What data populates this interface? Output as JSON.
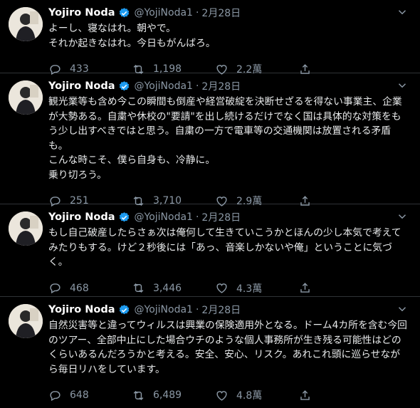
{
  "tweets": [
    {
      "name": "Yojiro Noda",
      "handle": "@YojiNoda1",
      "separator": "·",
      "date": "2月28日",
      "text": "よーし、寝なはれ。朝やで。\nそれか起きなはれ。今日もがんばろ。",
      "replies": "433",
      "retweets": "1,198",
      "likes": "2.2萬"
    },
    {
      "name": "Yojiro Noda",
      "handle": "@YojiNoda1",
      "separator": "·",
      "date": "2月28日",
      "text": "観光業等も含め今この瞬間も倒産や経営破綻を決断せざるを得ない事業主、企業が大勢ある。自粛や休校の\"要請\"を出し続けるだけでなく国は具体的な対策をもう少し出すべきではと思う。自粛の一方で電車等の交通機関は放置される矛盾も。\nこんな時こそ、僕ら自身も、冷静に。\n乗り切ろう。",
      "replies": "251",
      "retweets": "3,710",
      "likes": "2.9萬"
    },
    {
      "name": "Yojiro Noda",
      "handle": "@YojiNoda1",
      "separator": "·",
      "date": "2月28日",
      "text": "もし自己破産したらさぁ次は俺何して生きていこうかとほんの少し本気で考えてみたりもする。けど２秒後には「あっ、音楽しかないや俺」ということに気づく。",
      "replies": "468",
      "retweets": "3,446",
      "likes": "4.3萬"
    },
    {
      "name": "Yojiro Noda",
      "handle": "@YojiNoda1",
      "separator": "·",
      "date": "2月28日",
      "text": "自然災害等と違ってウィルスは興業の保険適用外となる。ドーム4カ所を含む今回のツアー、全部中止にした場合ウチのような個人事務所が生き残る可能性はどのくらいあるんだろうかと考える。安全、安心、リスク。あれこれ頭に巡らせながら毎日リハをしています。",
      "replies": "648",
      "retweets": "6,489",
      "likes": "4.8萬"
    }
  ],
  "colors": {
    "verified": "#1d9bf0",
    "muted": "#8b98a5",
    "divider": "#2f3336"
  },
  "icons": [
    "chevron-down-icon",
    "verified-badge-icon",
    "reply-icon",
    "retweet-icon",
    "like-icon",
    "share-icon"
  ]
}
